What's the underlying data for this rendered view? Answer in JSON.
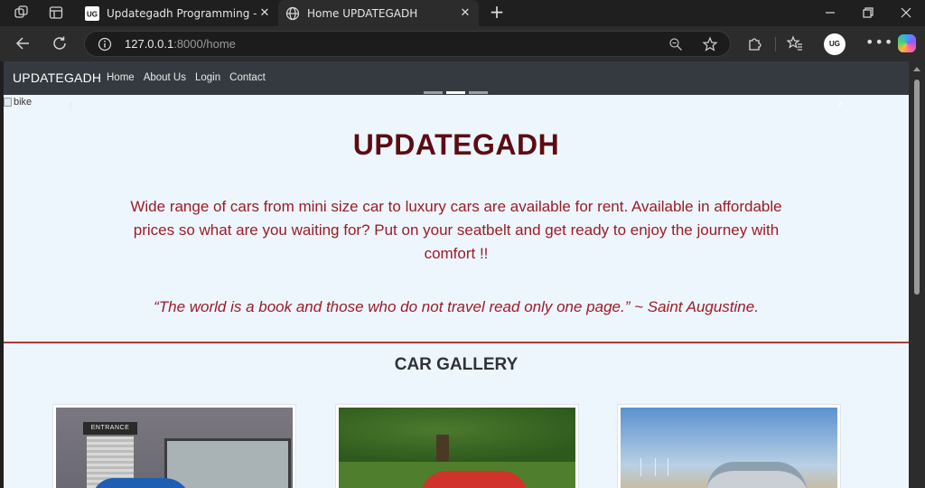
{
  "browser": {
    "tabs": [
      {
        "title": "Updategadh Programming - Upd",
        "favicon": "updategadh-logo-icon",
        "active": false
      },
      {
        "title": "Home UPDATEGADH",
        "favicon": "globe-icon",
        "active": true
      }
    ],
    "url_host": "127.0.0.1",
    "url_path": ":8000/home",
    "profile_initials": "UG"
  },
  "site": {
    "brand": "UPDATEGADH",
    "nav": [
      "Home",
      "About Us",
      "Login",
      "Contact"
    ],
    "carousel": {
      "img_alt": "bike",
      "indicators": 3,
      "active_indicator": 2,
      "prev_glyph": "‹",
      "next_glyph": "›"
    },
    "hero": {
      "title": "UPDATEGADH",
      "text": "Wide range of cars from mini size car to luxury cars are available for rent. Available in affordable prices so what are you waiting for? Put on your seatbelt and get ready to enjoy the journey with comfort !!",
      "quote": "“The world is a book and those who do not travel read only one page.” ~ Saint Augustine."
    },
    "gallery": {
      "title": "CAR GALLERY",
      "card1_sign": "ENTRANCE"
    }
  },
  "colors": {
    "navbar": "#343a40",
    "page_bg": "#eef6fd",
    "title": "#5b0d12",
    "text": "#9b1c26",
    "divider": "#b3373e"
  }
}
